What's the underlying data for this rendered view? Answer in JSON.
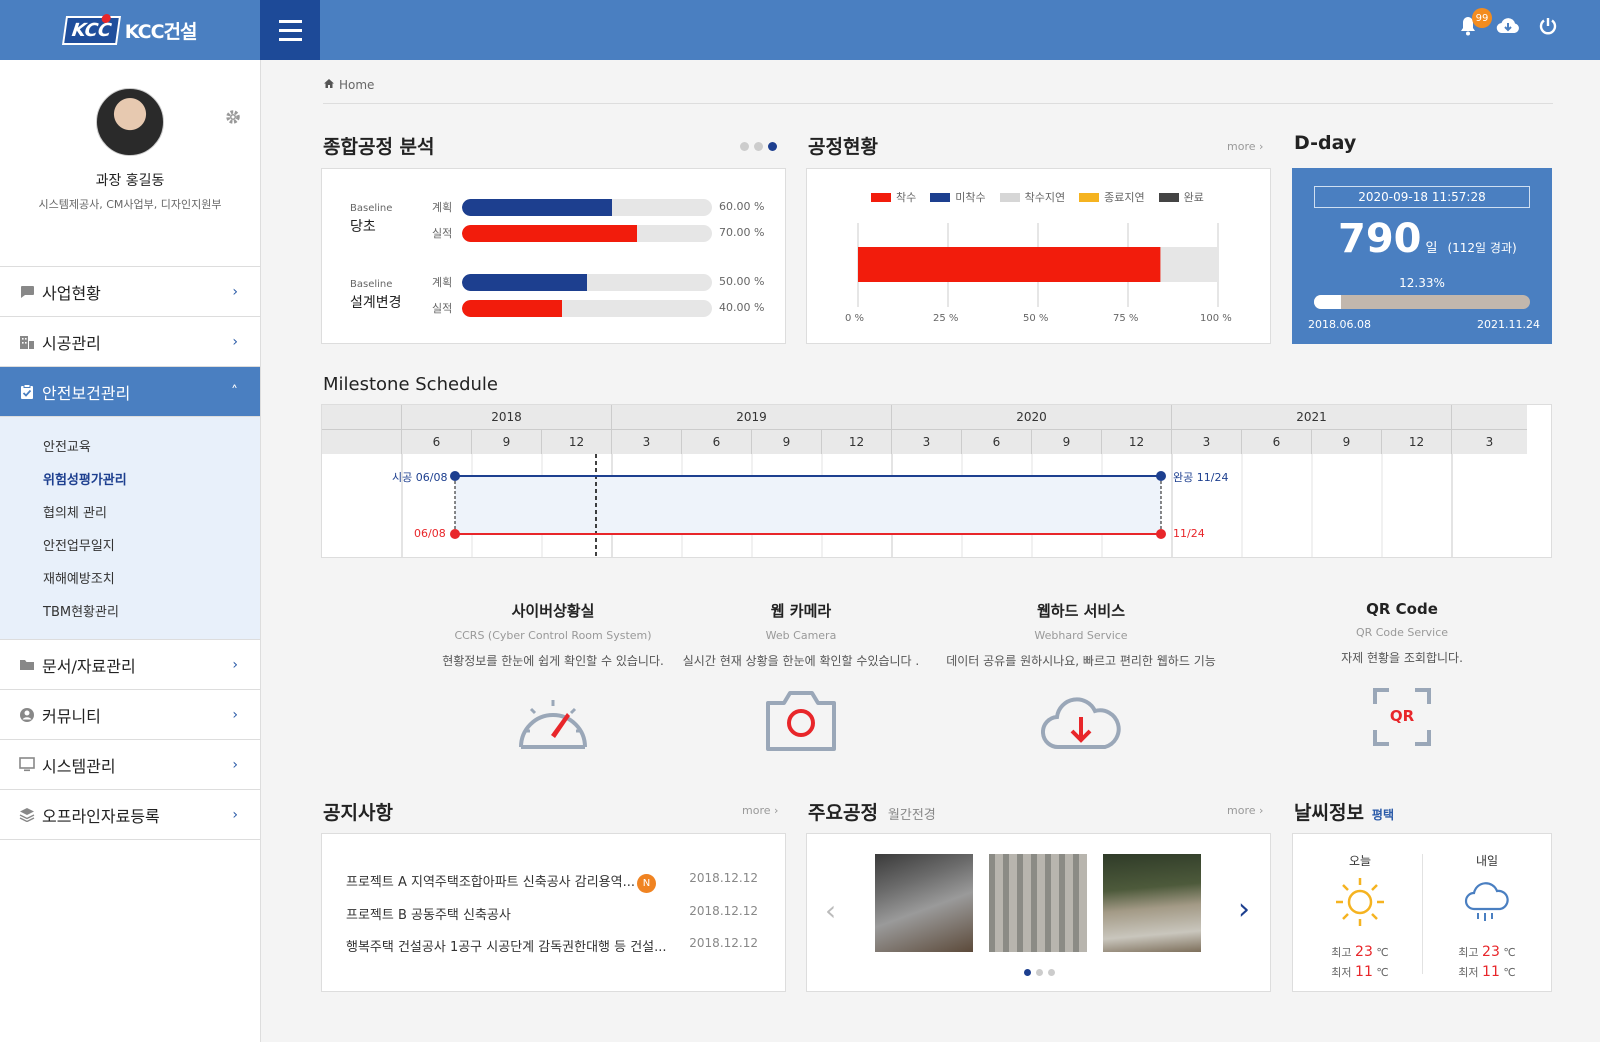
{
  "header": {
    "logo_mark": "KCC",
    "logo_text": "KCC건설",
    "notification_count": "99"
  },
  "profile": {
    "name": "과장 홍길동",
    "dept": "시스템제공사, CM사업부, 디자인지원부"
  },
  "menu": {
    "items": [
      {
        "label": "사업현황",
        "icon": "chat-icon"
      },
      {
        "label": "시공관리",
        "icon": "building-icon"
      },
      {
        "label": "안전보건관리",
        "icon": "clipboard-check-icon"
      },
      {
        "label": "문서/자료관리",
        "icon": "folder-icon"
      },
      {
        "label": "커뮤니티",
        "icon": "user-circle-icon"
      },
      {
        "label": "시스템관리",
        "icon": "monitor-icon"
      },
      {
        "label": "오프라인자료등록",
        "icon": "stack-icon"
      }
    ],
    "submenu": [
      "안전교육",
      "위험성평가관리",
      "협의체 관리",
      "안전업무일지",
      "재해예방조치",
      "TBM현황관리"
    ]
  },
  "breadcrumb": "Home",
  "analysis": {
    "title": "종합공정 분석",
    "groups": [
      {
        "tag": "Baseline",
        "name": "당초",
        "rows": [
          {
            "label": "계획",
            "percent": 60,
            "text": "60.00 %"
          },
          {
            "label": "실적",
            "percent": 70,
            "text": "70.00 %"
          }
        ]
      },
      {
        "tag": "Baseline",
        "name": "설계변경",
        "rows": [
          {
            "label": "계획",
            "percent": 50,
            "text": "50.00 %"
          },
          {
            "label": "실적",
            "percent": 40,
            "text": "40.00 %"
          }
        ]
      }
    ]
  },
  "status": {
    "title": "공정현황",
    "more": "more",
    "legend": [
      "착수",
      "미착수",
      "착수지연",
      "종료지연",
      "완료"
    ],
    "legend_colors": [
      "#f21c0c",
      "#1d3f8f",
      "#d6d6d6",
      "#f5b320",
      "#444444"
    ],
    "axis": [
      "0 %",
      "25 %",
      "50 %",
      "75 %",
      "100 %"
    ],
    "started_percent": 84
  },
  "dday": {
    "title": "D-day",
    "datetime": "2020-09-18   11:57:28",
    "days": "790",
    "unit": "일",
    "elapsed": "(112일 경과)",
    "percent_text": "12.33%",
    "progress": 0.1233,
    "start": "2018.06.08",
    "end": "2021.11.24"
  },
  "milestone": {
    "title": "Milestone Schedule",
    "years": [
      "2018",
      "2019",
      "2020",
      "2021"
    ],
    "months": [
      "6",
      "9",
      "12",
      "3",
      "6",
      "9",
      "12",
      "3",
      "6",
      "9",
      "12",
      "3",
      "6",
      "9",
      "12",
      "3"
    ],
    "plan_start": "시공 06/08",
    "plan_end": "완공 11/24",
    "actual_start": "06/08",
    "actual_end": "11/24"
  },
  "services": [
    {
      "title": "사이버상황실",
      "sub": "CCRS (Cyber Control Room System)",
      "desc": "현황정보를 한눈에 쉽게 확인할 수 있습니다."
    },
    {
      "title": "웹 카메라",
      "sub": "Web Camera",
      "desc": "실시간 현재 상황을 한눈에 확인할 수있습니다 ."
    },
    {
      "title": "웹하드 서비스",
      "sub": "Webhard Service",
      "desc": "데이터 공유를 원하시나요, 빠르고 편리한 웹하드 기능"
    },
    {
      "title": "QR Code",
      "sub": "QR Code Service",
      "desc": "자제 현황을 조회합니다.",
      "qr_text": "QR"
    }
  ],
  "notice": {
    "title": "공지사항",
    "more": "more",
    "items": [
      {
        "text": "프로젝트 A 지역주택조합아파트 신축공사 감리용역...",
        "date": "2018.12.12",
        "badge": "N"
      },
      {
        "text": "프로젝트 B 공동주택 신축공사",
        "date": "2018.12.12"
      },
      {
        "text": "행복주택 건설공사 1공구 시공단계 감독권한대행 등 건설...",
        "date": "2018.12.12"
      }
    ]
  },
  "major": {
    "title": "주요공정",
    "subtitle": "월간전경",
    "more": "more"
  },
  "weather": {
    "title": "날씨정보",
    "location": "평택",
    "today": {
      "label": "오늘",
      "high_label": "최고",
      "high": "23",
      "low_label": "최저",
      "low": "11",
      "unit": "℃"
    },
    "tomorrow": {
      "label": "내일",
      "high_label": "최고",
      "high": "23",
      "low_label": "최저",
      "low": "11",
      "unit": "℃"
    }
  }
}
